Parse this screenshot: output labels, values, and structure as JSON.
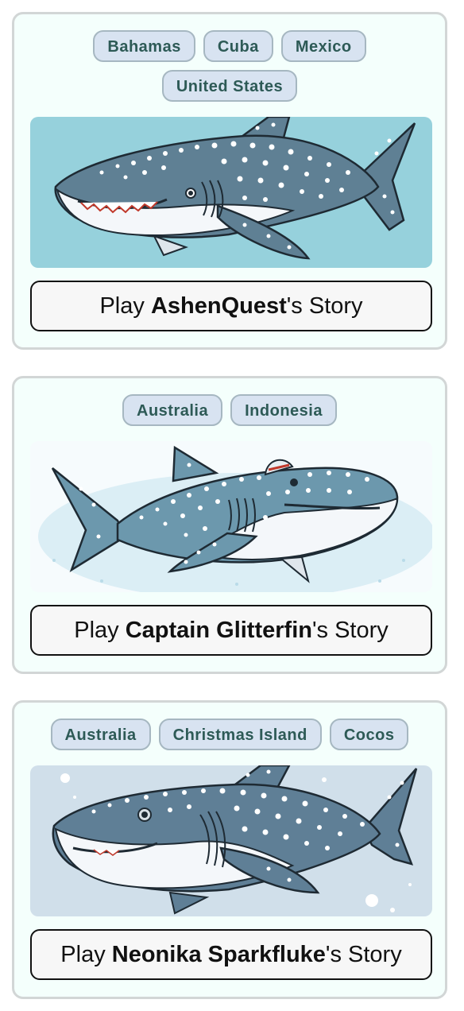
{
  "cards": [
    {
      "tags": [
        "Bahamas",
        "Cuba",
        "Mexico",
        "United States"
      ],
      "play_prefix": "Play ",
      "name": "AshenQuest",
      "play_suffix": "'s Story",
      "image_bg": "#96d1dc"
    },
    {
      "tags": [
        "Australia",
        "Indonesia"
      ],
      "play_prefix": "Play ",
      "name": "Captain Glitterfin",
      "play_suffix": "'s Story",
      "image_bg": "#f6fbfd"
    },
    {
      "tags": [
        "Australia",
        "Christmas Island",
        "Cocos"
      ],
      "play_prefix": "Play ",
      "name": "Neonika Sparkfluke",
      "play_suffix": "'s Story",
      "image_bg": "#d0dfea"
    }
  ],
  "colors": {
    "shark_body": "#5f8094",
    "shark_belly": "#f4f7fa",
    "card_bg": "#f4fffc",
    "tag_bg": "#d8e3f1",
    "tag_text": "#2d5a56"
  }
}
